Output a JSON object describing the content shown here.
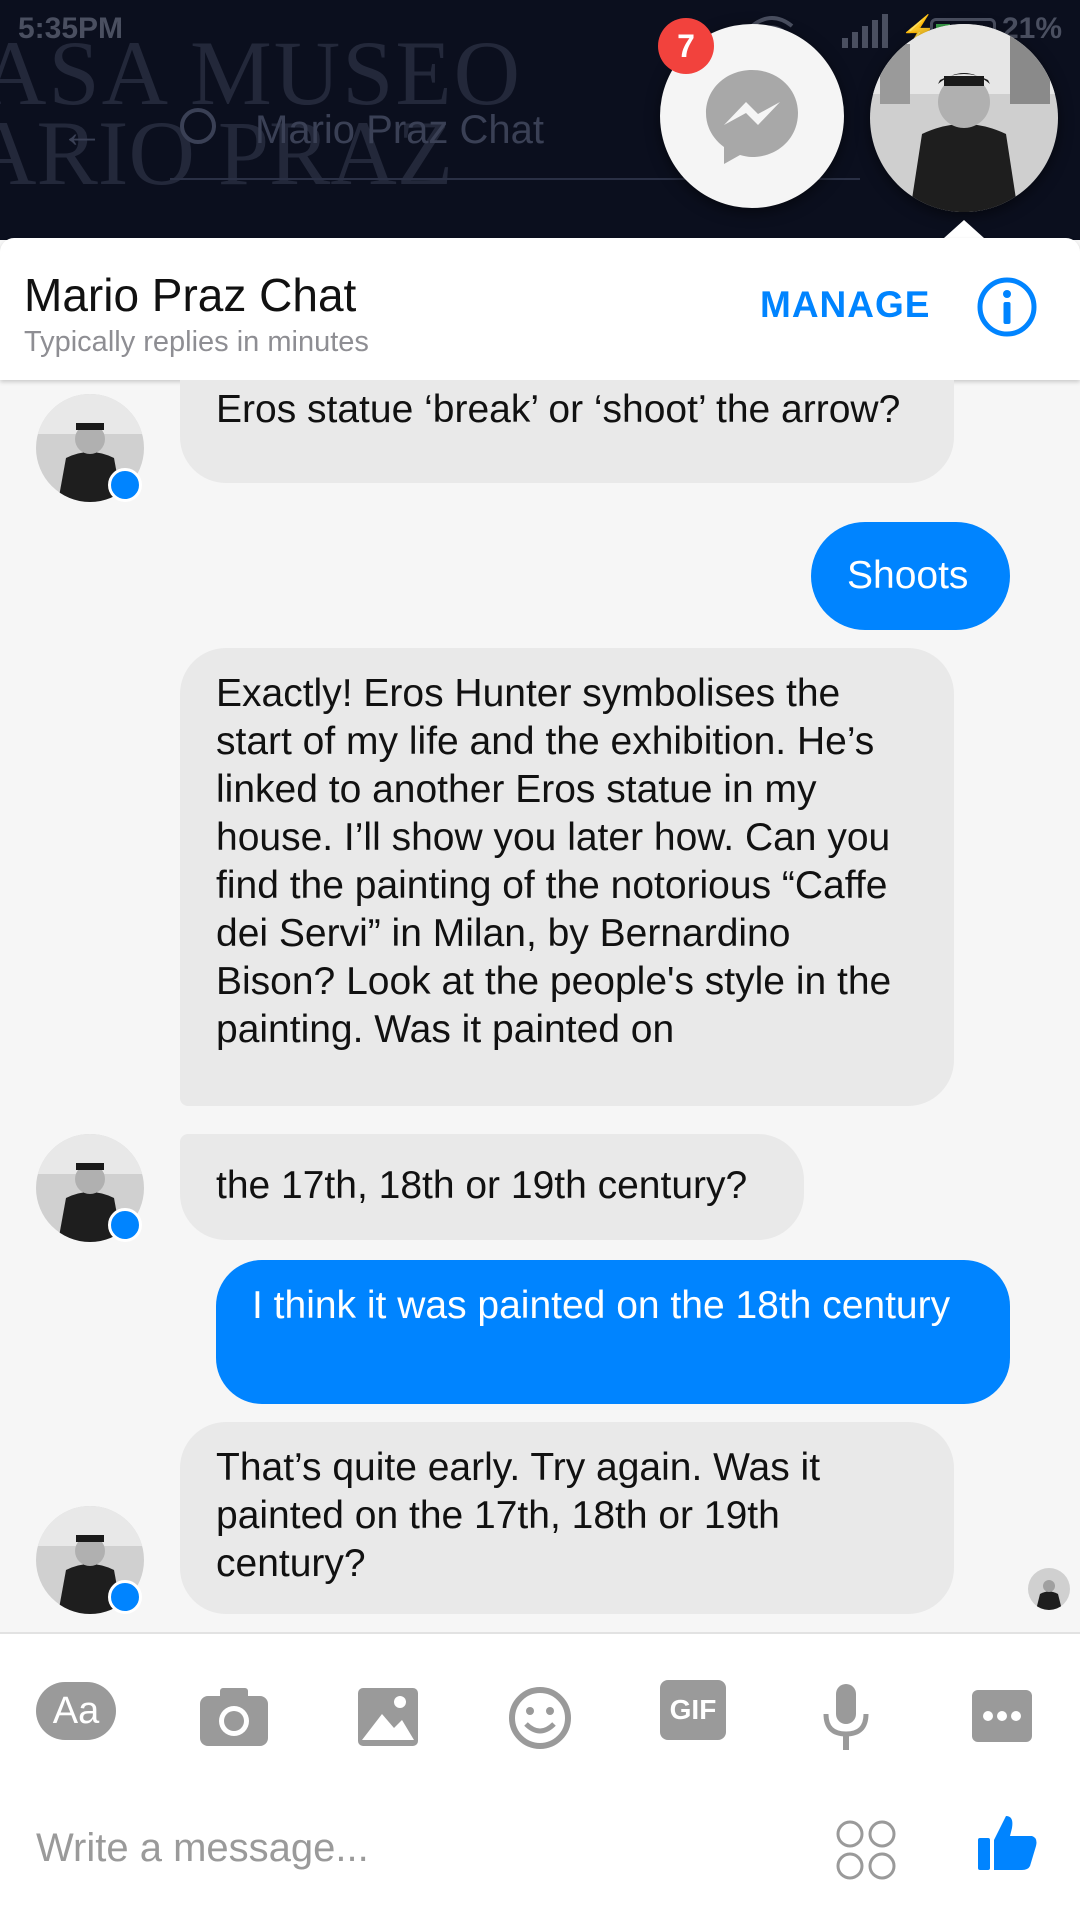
{
  "status_bar": {
    "time": "5:35PM",
    "battery": "21%"
  },
  "background": {
    "museo_line1": "ASA MUSEO",
    "museo_line2": "ARIO PRAZ",
    "appbar_title": "Mario Praz Chat"
  },
  "chat_heads": {
    "badge_count": "7"
  },
  "header": {
    "title": "Mario Praz Chat",
    "subtitle": "Typically replies in minutes",
    "manage_label": "MANAGE"
  },
  "messages": [
    {
      "from": "bot",
      "text": "Eros statue ‘break’ or ‘shoot’ the arrow?"
    },
    {
      "from": "user",
      "text": "Shoots"
    },
    {
      "from": "bot",
      "text": "Exactly! Eros Hunter symbolises the start of my life and the exhibition. He’s linked to another Eros statue in my house. I’ll show you later how. Can you find the painting of the notorious “Caffe dei Servi” in Milan, by Bernardino Bison? Look at the people's style in the painting. Was it painted on"
    },
    {
      "from": "bot",
      "text": "the 17th, 18th or 19th century?"
    },
    {
      "from": "user",
      "text": "I think it was painted on the 18th century"
    },
    {
      "from": "bot",
      "text": "That’s quite early. Try again. Was it painted on the 17th, 18th or 19th century?"
    }
  ],
  "composer": {
    "aa_label": "Aa",
    "gif_label": "GIF",
    "placeholder": "Write a message..."
  },
  "colors": {
    "accent": "#0084ff",
    "incoming_bubble": "#e9e9e9",
    "badge": "#f2423d"
  }
}
